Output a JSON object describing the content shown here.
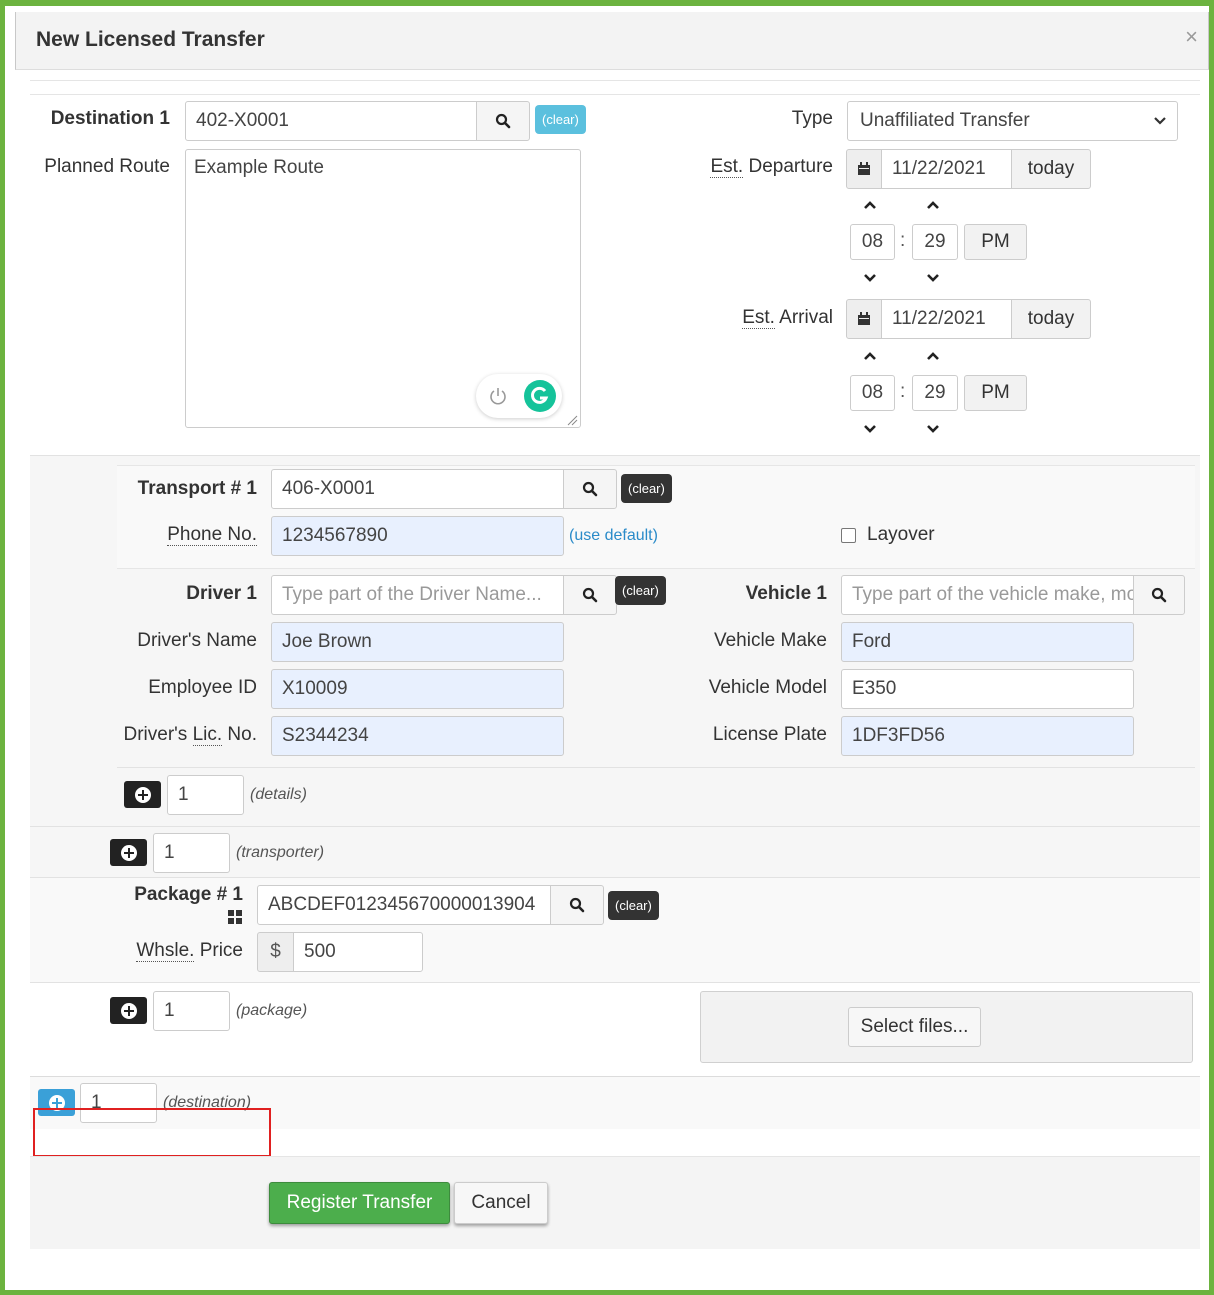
{
  "dialog": {
    "title": "New Licensed Transfer",
    "close_glyph": "×"
  },
  "destination": {
    "label": "Destination 1",
    "value": "402-X0001",
    "clear": "(clear)",
    "planned_route_label": "Planned Route",
    "planned_route": "Example Route",
    "type_label": "Type",
    "type_value": "Unaffiliated Transfer",
    "departure_label": "Departure",
    "departure_abbr": "Est.",
    "departure_date": "11/22/2021",
    "departure_today": "today",
    "departure_hour": "08",
    "departure_minute": "29",
    "departure_ampm": "PM",
    "arrival_label": "Arrival",
    "arrival_abbr": "Est.",
    "arrival_date": "11/22/2021",
    "arrival_today": "today",
    "arrival_hour": "08",
    "arrival_minute": "29",
    "arrival_ampm": "PM",
    "time_sep": ":"
  },
  "transport": {
    "label": "Transport # 1",
    "value": "406-X0001",
    "clear": "(clear)",
    "phone_label": "Phone No.",
    "phone": "1234567890",
    "use_default": "(use default)",
    "layover_label": "Layover"
  },
  "driver": {
    "label": "Driver 1",
    "placeholder": "Type part of the Driver Name...",
    "clear": "(clear)",
    "name_label": "Driver's Name",
    "name": "Joe Brown",
    "employee_label": "Employee ID",
    "employee": "X10009",
    "lic_label_pre": "Driver's ",
    "lic_label_abbr": "Lic.",
    "lic_label_post": " No.",
    "lic": "S2344234"
  },
  "vehicle": {
    "label": "Vehicle 1",
    "placeholder": "Type part of the vehicle make, mo",
    "make_label": "Vehicle Make",
    "make": "Ford",
    "model_label": "Vehicle Model",
    "model": "E350",
    "plate_label": "License Plate",
    "plate": "1DF3FD56"
  },
  "adders": {
    "details_count": "1",
    "details_label": "(details)",
    "transporter_count": "1",
    "transporter_label": "(transporter)",
    "package_count": "1",
    "package_label": "(package)",
    "destination_count": "1",
    "destination_label": "(destination)"
  },
  "package": {
    "label": "Package # 1",
    "value": "ABCDEF012345670000013904",
    "clear": "(clear)",
    "price_label_abbr": "Whsle.",
    "price_label_post": " Price",
    "currency": "$",
    "price": "500",
    "select_files": "Select files..."
  },
  "footer": {
    "register": "Register Transfer",
    "cancel": "Cancel"
  },
  "colors": {
    "frame_green": "#6cb33f",
    "register_green": "#4cae4c",
    "highlight_red": "#e02020",
    "field_blue": "#e8f0fe"
  }
}
